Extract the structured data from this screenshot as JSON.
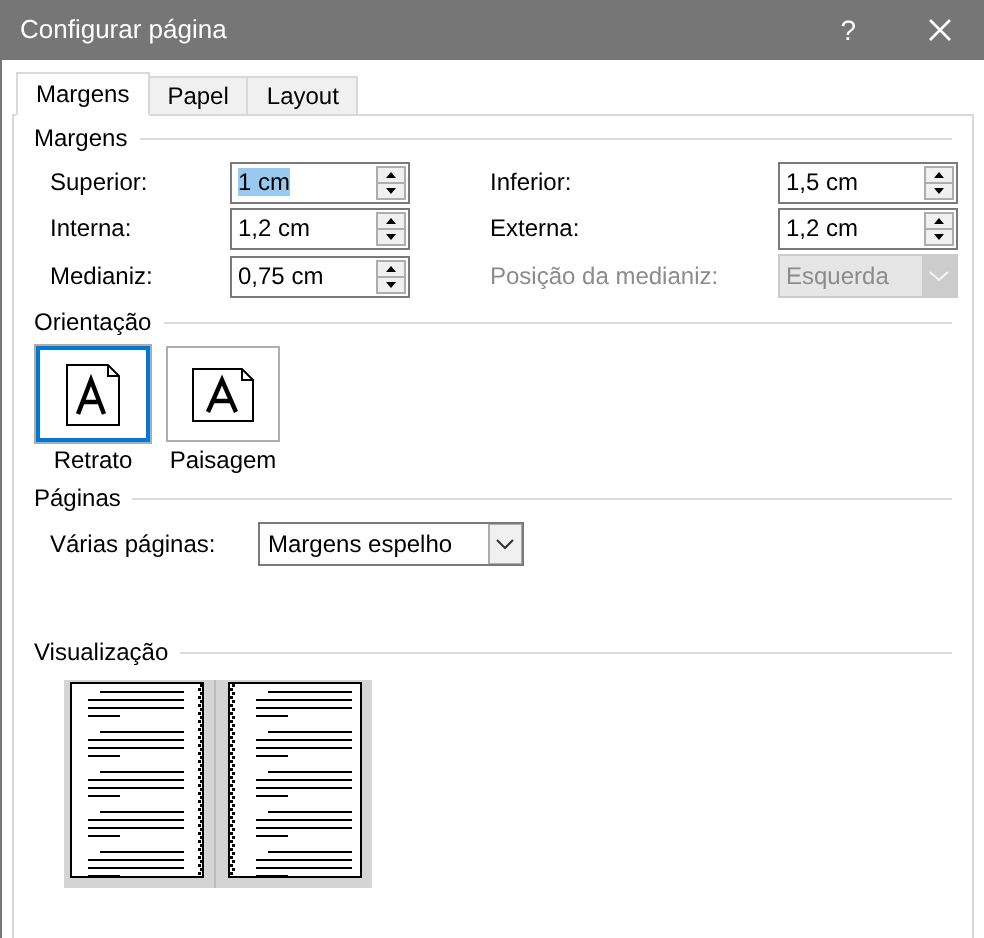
{
  "window": {
    "title": "Configurar página",
    "help": "?"
  },
  "tabs": [
    {
      "label": "Margens",
      "selected": true
    },
    {
      "label": "Papel",
      "selected": false
    },
    {
      "label": "Layout",
      "selected": false
    }
  ],
  "margins": {
    "heading": "Margens",
    "fields": [
      {
        "label": "Superior:",
        "value": "1 cm",
        "kind": "spin",
        "disabled": false,
        "focused": true
      },
      {
        "label": "Inferior:",
        "value": "1,5 cm",
        "kind": "spin",
        "disabled": false,
        "focused": false
      },
      {
        "label": "Interna:",
        "value": "1,2 cm",
        "kind": "spin",
        "disabled": false,
        "focused": false
      },
      {
        "label": "Externa:",
        "value": "1,2 cm",
        "kind": "spin",
        "disabled": false,
        "focused": false
      },
      {
        "label": "Medianiz:",
        "value": "0,75 cm",
        "kind": "spin",
        "disabled": false,
        "focused": false
      },
      {
        "label": "Posição da medianiz:",
        "value": "Esquerda",
        "kind": "select",
        "disabled": true,
        "focused": false
      }
    ]
  },
  "orientation": {
    "heading": "Orientação",
    "options": [
      {
        "label": "Retrato",
        "kind": "portrait",
        "selected": true
      },
      {
        "label": "Paisagem",
        "kind": "landscape",
        "selected": false
      }
    ]
  },
  "pages": {
    "heading": "Páginas",
    "label": "Várias páginas:",
    "value": "Margens espelho"
  },
  "preview": {
    "heading": "Visualização"
  }
}
